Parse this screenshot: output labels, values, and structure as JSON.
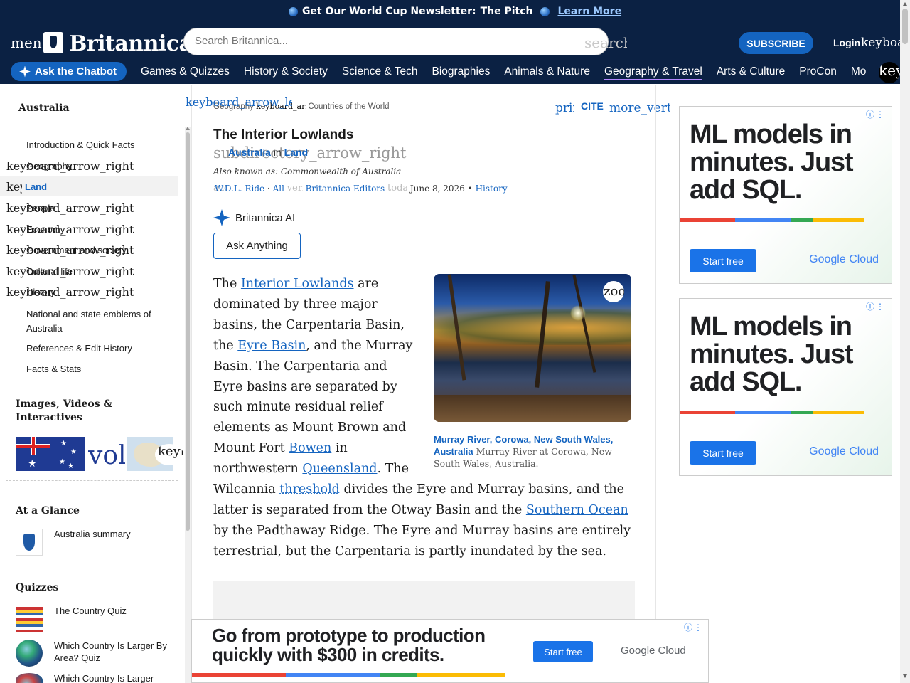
{
  "promo": {
    "text": "Get Our World Cup Newsletter:",
    "pitch": "The Pitch",
    "link": "Learn More"
  },
  "header": {
    "menu_icon": "menu",
    "logo": "Britannica",
    "search_placeholder": "Search Britannica...",
    "search_icon": "search",
    "subscribe": "SUBSCRIBE",
    "login": "Login",
    "login_icon": "keyboard_arrow_down"
  },
  "nav": {
    "chatbot": "Ask the Chatbot",
    "items": [
      "Games & Quizzes",
      "History & Society",
      "Science & Tech",
      "Biographies",
      "Animals & Nature",
      "Geography & Travel",
      "Arts & Culture",
      "ProCon",
      "Mo"
    ],
    "more_icon": "keyboard_arrow_right"
  },
  "toc": {
    "title": "Australia",
    "items": [
      "Introduction & Quick Facts",
      "Geography",
      "Land",
      "People",
      "Economy",
      "Government and society",
      "Cultural life",
      "History",
      "National and state emblems of Australia",
      "References & Edit History",
      "Facts & Stats"
    ],
    "expand_icon": "keyboard_arrow_right",
    "media_title": "Images, Videos & Interactives",
    "media_vol": "vol",
    "media_key": "keyb",
    "glance_title": "At a Glance",
    "glance_item": "Australia summary",
    "quizzes_title": "Quizzes",
    "quizzes": [
      "The Country Quiz",
      "Which Country Is Larger By Area? Quiz",
      "Which Country Is Larger"
    ]
  },
  "article": {
    "back_icon": "keyboard_arrow_left",
    "breadcrumb": "Geography",
    "breadcrumb_sep": "keyboard_arrow_right",
    "breadcrumb_2": "Countries of the World",
    "print_icon": "print",
    "cite": "CITE",
    "more_icon": "more_vert",
    "title": "The Interior Lowlands",
    "subdir_ghost": "subdirectory_arrow_right",
    "subdir_link1": "Australia",
    "subdir_in": "in",
    "subdir_link2": "Land",
    "aka": "Also known as: Commonwealth of Australia",
    "byline_ghost1": "account_circle",
    "byline_author": "W.D.L. Ride",
    "byline_all": "All",
    "byline_ghost2": "verified",
    "byline_editors": "Britannica Editors",
    "byline_ghost3": "today",
    "byline_date": "June 8, 2026",
    "byline_history": "History",
    "ai_label": "Britannica AI",
    "ask_button": "Ask Anything",
    "zoom_icon": "zoom_in",
    "caption_title": "Murray River, Corowa, New South Wales, Australia",
    "caption_text": "Murray River at Corowa, New South Wales, Australia.",
    "body": {
      "p1": "The",
      "l1": "Interior Lowlands",
      "p2": "are dominated by three major basins, the Carpentaria Basin, the",
      "l2": "Eyre Basin",
      "p3": ", and the Murray Basin. The Carpentaria and Eyre basins are separated by such minute residual relief elements as Mount Brown and Mount Fort",
      "l3": "Bowen",
      "p4": "in northwestern",
      "l4": "Queensland",
      "p5": ". The Wilcannia",
      "l5": "threshold",
      "p6": "divides the Eyre and Murray basins, and the latter is separated from the Otway Basin and the",
      "l6": "Southern Ocean",
      "p7": "by the Padthaway Ridge. The Eyre and Murray basins are entirely terrestrial, but the Carpentaria is partly inundated by the sea."
    }
  },
  "ads": {
    "right_head": "ML models in minutes. Just add SQL.",
    "right_cta": "Start free",
    "brand": "Google Cloud",
    "bottom_head": "Go from prototype to production quickly with $300 in credits.",
    "bottom_cta": "Start free"
  }
}
